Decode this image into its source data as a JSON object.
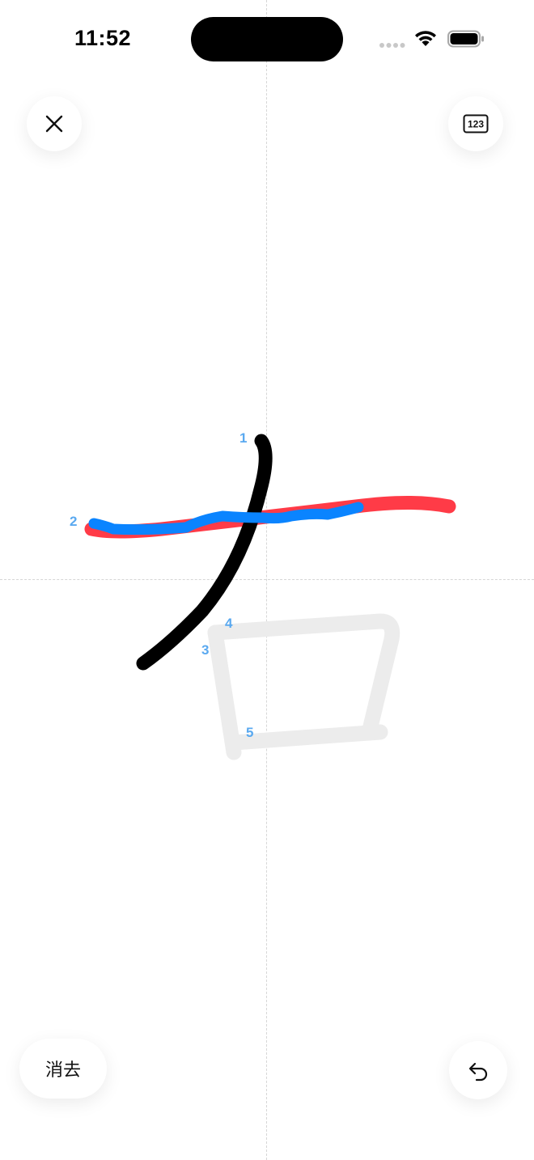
{
  "status_bar": {
    "time": "11:52"
  },
  "toolbar": {
    "close_icon": "close-icon",
    "numeric_keyboard_label": "123"
  },
  "writing_area": {
    "stroke_numbers": [
      "1",
      "2",
      "3",
      "4",
      "5"
    ],
    "colors": {
      "written_stroke": "#000000",
      "reference_stroke": "#ff3b47",
      "active_stroke": "#0a84ff",
      "guide_stroke": "#ececec",
      "stroke_number": "#5aa9f0"
    }
  },
  "bottom_bar": {
    "erase_label": "消去",
    "undo_icon": "undo-icon"
  }
}
